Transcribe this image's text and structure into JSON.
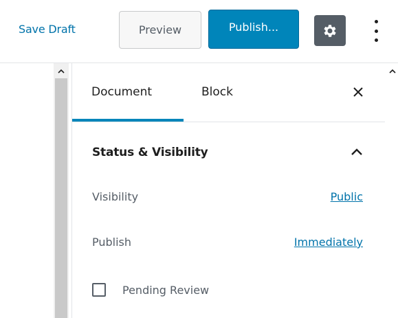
{
  "toolbar": {
    "save_draft": "Save Draft",
    "preview": "Preview",
    "publish": "Publish...",
    "settings_icon": "gear-icon",
    "more_icon": "vertical-ellipsis-icon"
  },
  "sidebar": {
    "tabs": [
      {
        "label": "Document",
        "active": true
      },
      {
        "label": "Block",
        "active": false
      }
    ],
    "close_icon": "close-icon",
    "section": {
      "title": "Status & Visibility",
      "expanded": true,
      "rows": [
        {
          "label": "Visibility",
          "value": "Public"
        },
        {
          "label": "Publish",
          "value": "Immediately"
        }
      ],
      "checkbox": {
        "label": "Pending Review",
        "checked": false
      }
    }
  },
  "colors": {
    "accent": "#0085ba",
    "link": "#0073aa",
    "settings_bg": "#555d66"
  }
}
